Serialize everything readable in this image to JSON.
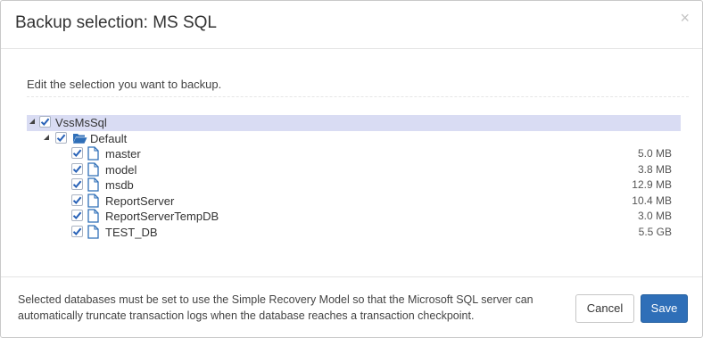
{
  "dialog": {
    "title": "Backup selection: MS SQL",
    "close_glyph": "×",
    "instruction": "Edit the selection you want to backup."
  },
  "tree": {
    "root": {
      "label": "VssMsSql",
      "checked": true,
      "expanded": true,
      "icon": "none"
    },
    "group": {
      "label": "Default",
      "checked": true,
      "expanded": true,
      "icon": "folder-open-icon"
    },
    "databases": [
      {
        "name": "master",
        "size": "5.0 MB",
        "checked": true,
        "icon": "file-icon"
      },
      {
        "name": "model",
        "size": "3.8 MB",
        "checked": true,
        "icon": "file-icon"
      },
      {
        "name": "msdb",
        "size": "12.9 MB",
        "checked": true,
        "icon": "file-icon"
      },
      {
        "name": "ReportServer",
        "size": "10.4 MB",
        "checked": true,
        "icon": "file-icon"
      },
      {
        "name": "ReportServerTempDB",
        "size": "3.0 MB",
        "checked": true,
        "icon": "file-icon"
      },
      {
        "name": "TEST_DB",
        "size": "5.5 GB",
        "checked": true,
        "icon": "file-icon"
      }
    ]
  },
  "footer": {
    "note": "Selected databases must be set to use the Simple Recovery Model so that the Microsoft SQL server can automatically truncate transaction logs when the database reaches a transaction checkpoint.",
    "cancel_label": "Cancel",
    "save_label": "Save"
  },
  "colors": {
    "accent": "#2f6fb8",
    "selected_row": "#d9dcf3",
    "checkmark": "#2a63b8"
  }
}
